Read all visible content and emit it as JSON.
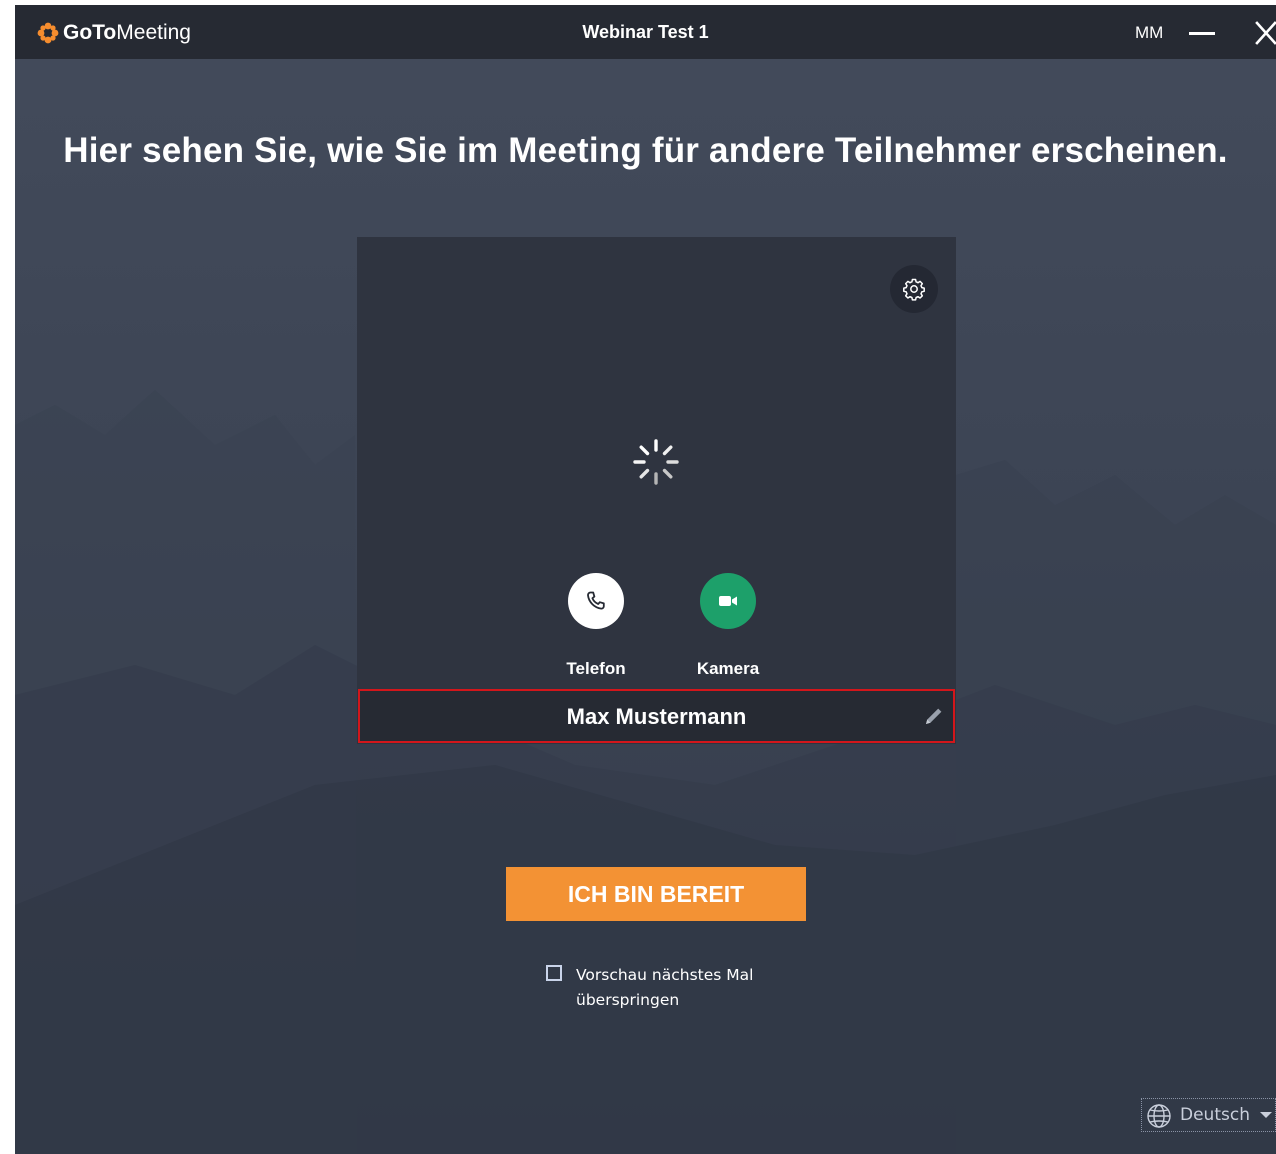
{
  "titlebar": {
    "logo_bold": "GoTo",
    "logo_regular": "Meeting",
    "window_title": "Webinar Test 1",
    "user_initials": "MM",
    "logo_icon": "gotomeeting-flower-icon",
    "minimize_icon": "minimize-icon",
    "close_icon": "close-icon"
  },
  "main": {
    "headline": "Hier sehen Sie, wie Sie im Meeting für andere Teilnehmer erscheinen."
  },
  "preview": {
    "settings_icon": "gear-icon",
    "status_icon": "loading-spinner-icon",
    "phone": {
      "label": "Telefon",
      "icon": "phone-icon"
    },
    "camera": {
      "label": "Kamera",
      "icon": "video-camera-icon"
    },
    "participant_name": "Max Mustermann",
    "edit_icon": "pencil-icon"
  },
  "ready_button": {
    "label": "ICH BIN BEREIT"
  },
  "skip_preview": {
    "checked": false,
    "label": "Vorschau nächstes Mal überspringen"
  },
  "language": {
    "selected": "Deutsch",
    "icon": "globe-icon"
  },
  "colors": {
    "titlebar": "#262a33",
    "accent_orange": "#f39234",
    "camera_green": "#1da06a",
    "highlight_red": "#d3161b",
    "logo_orange": "#f68d2e"
  }
}
